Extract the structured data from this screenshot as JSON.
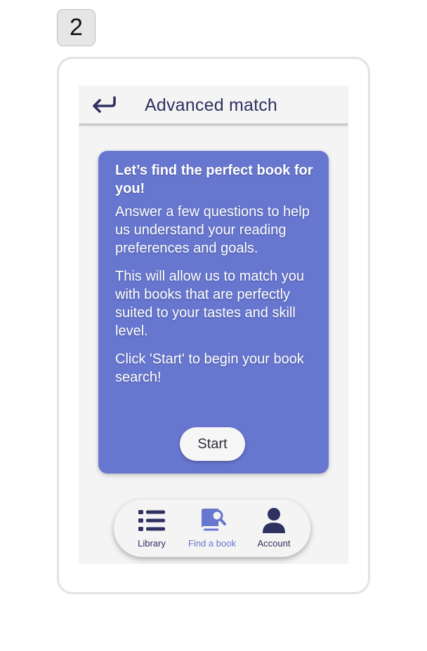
{
  "step_number": "2",
  "header": {
    "title": "Advanced match"
  },
  "card": {
    "heading": "Let’s find the perfect book for you!",
    "paragraphs": [
      "Answer a few questions to help us understand your reading preferences and goals.",
      "This will allow us to match you with books that are perfectly suited to your tastes and skill level.",
      "Click 'Start' to begin your book search!"
    ],
    "start_label": "Start"
  },
  "nav": {
    "items": [
      {
        "label": "Library",
        "icon": "list-icon",
        "active": false
      },
      {
        "label": "Find a book",
        "icon": "book-search-icon",
        "active": true
      },
      {
        "label": "Account",
        "icon": "user-icon",
        "active": false
      }
    ]
  },
  "colors": {
    "accent": "#6776cf",
    "dark": "#2f3160",
    "screen_bg": "#f4f4f4"
  }
}
